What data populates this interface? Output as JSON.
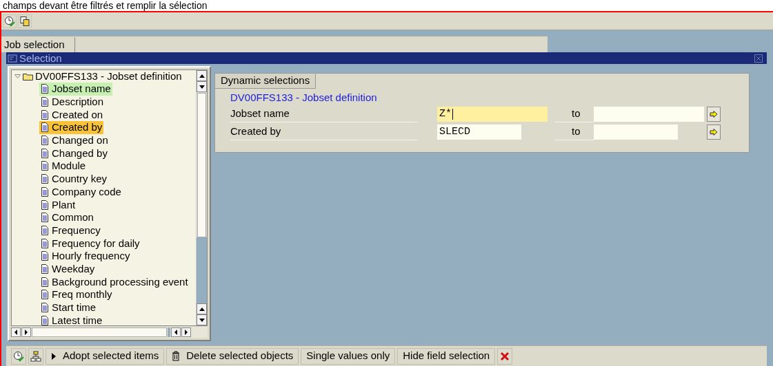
{
  "caption": "champs devant être filtrés et remplir la sélection",
  "tab": {
    "label": "Job selection"
  },
  "dialog": {
    "title": "Selection"
  },
  "tree": {
    "root": {
      "label": "DV00FFS133 - Jobset definition",
      "expanded": true,
      "children": [
        {
          "label": "Jobset name",
          "color": "#c6f0b2"
        },
        {
          "label": "Description"
        },
        {
          "label": "Created on"
        },
        {
          "label": "Created by",
          "color": "#f8c23a"
        },
        {
          "label": "Changed on"
        },
        {
          "label": "Changed by"
        },
        {
          "label": "Module"
        },
        {
          "label": "Country key"
        },
        {
          "label": "Company code"
        },
        {
          "label": "Plant"
        },
        {
          "label": "Common"
        },
        {
          "label": "Frequency"
        },
        {
          "label": "Frequency for daily"
        },
        {
          "label": "Hourly frequency"
        },
        {
          "label": "Weekday"
        },
        {
          "label": "Background processing event"
        },
        {
          "label": "Freq monthly"
        },
        {
          "label": "Start time"
        },
        {
          "label": "Latest time"
        }
      ]
    }
  },
  "dynamic_selections": {
    "title": "Dynamic selections",
    "group": "DV00FFS133 - Jobset definition",
    "rows": [
      {
        "label": "Jobset name",
        "low": "Z*",
        "focused": true,
        "to": "to",
        "high": ""
      },
      {
        "label": "Created by",
        "low": "SLECD",
        "focused": false,
        "to": "to",
        "high": ""
      }
    ]
  },
  "buttons": [
    {
      "kind": "execute"
    },
    {
      "kind": "hierarchy"
    },
    {
      "kind": "adopt",
      "label": "Adopt selected items"
    },
    {
      "kind": "delete",
      "label": "Delete selected objects"
    },
    {
      "kind": "text",
      "label": "Single values only"
    },
    {
      "kind": "text",
      "label": "Hide field selection"
    },
    {
      "kind": "cancel"
    }
  ]
}
